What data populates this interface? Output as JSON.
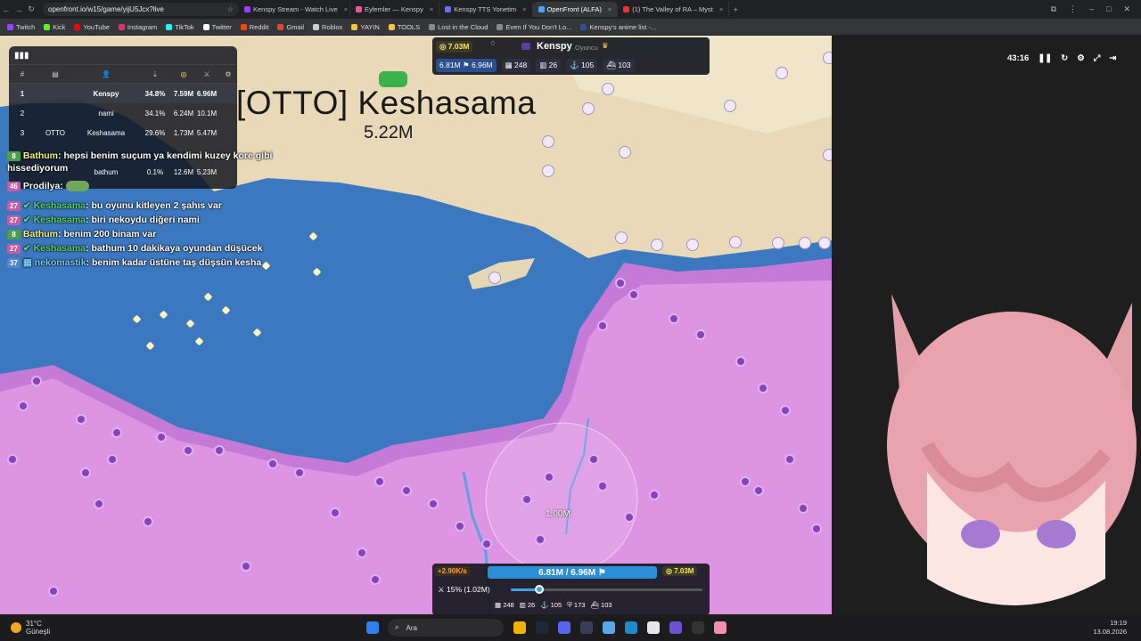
{
  "browser": {
    "url": "openfront.io/w15/game/yijU5Jcx?live",
    "tabs": [
      {
        "label": "Kenspy Stream - Watch Live",
        "color": "#9146ff"
      },
      {
        "label": "Eylemler — Kenspy",
        "color": "#ff4f9a"
      },
      {
        "label": "Kenspy TTS Yonetim",
        "color": "#6b6bff"
      },
      {
        "label": "OpenFront (ALFA)",
        "color": "#4fa3ff"
      },
      {
        "label": "(1) The Valley of RA – Myst",
        "color": "#ff2d2d"
      }
    ],
    "bookmarks": [
      {
        "label": "Twitch",
        "color": "#9146ff"
      },
      {
        "label": "Kick",
        "color": "#53fc18"
      },
      {
        "label": "YouTube",
        "color": "#ff0000"
      },
      {
        "label": "Instagram",
        "color": "#e1306c"
      },
      {
        "label": "TikTok",
        "color": "#25f4ee"
      },
      {
        "label": "Twitter",
        "color": "#ffffff"
      },
      {
        "label": "Reddit",
        "color": "#ff4500"
      },
      {
        "label": "Gmail",
        "color": "#ea4335"
      },
      {
        "label": "Roblox",
        "color": "#cccccc"
      },
      {
        "label": "YAYIN",
        "color": "#f5c542"
      },
      {
        "label": "TOOLS",
        "color": "#f5c542"
      },
      {
        "label": "Lost in the Cloud",
        "color": "#888888"
      },
      {
        "label": "Even If You Don't Lo...",
        "color": "#888888"
      },
      {
        "label": "Kenspy's anime list -...",
        "color": "#2e51a2"
      }
    ]
  },
  "map": {
    "player_name": "[OTTO] Keshasama",
    "player_troops": "5.22M",
    "cursor_label": "1.00M"
  },
  "leaderboard": {
    "rows": [
      {
        "rank": "1",
        "clan": "",
        "name": "Kenspy",
        "land": "34.8%",
        "gold": "7.59M",
        "troops": "6.96M",
        "me": true
      },
      {
        "rank": "2",
        "clan": "",
        "name": "nami",
        "land": "34.1%",
        "gold": "6.24M",
        "troops": "10.1M",
        "me": false
      },
      {
        "rank": "3",
        "clan": "OTTO",
        "name": "Keshasama",
        "land": "29.6%",
        "gold": "1.73M",
        "troops": "5.47M",
        "me": false
      },
      {
        "rank": "",
        "clan": "",
        "name": "bathum",
        "land": "0.1%",
        "gold": "12.6M",
        "troops": "5.23M",
        "me": false
      }
    ]
  },
  "chat": {
    "messages": [
      {
        "badge": "8",
        "badge_class": "b-green",
        "user": "Bathum",
        "user_class": "u-yellow",
        "verified": false,
        "text": "hepsi benim suçum ya kendimi kuzey kore gibi hissediyorum"
      },
      {
        "badge": "46",
        "badge_class": "b-pink",
        "user": "Prodilya",
        "user_class": "",
        "verified": false,
        "text": ""
      },
      {
        "badge": "27",
        "badge_class": "b-pink",
        "user": "Keshasama",
        "user_class": "u-green",
        "verified": true,
        "text": "bu oyunu kitleyen 2 şahıs var"
      },
      {
        "badge": "27",
        "badge_class": "b-pink",
        "user": "Keshasama",
        "user_class": "u-green",
        "verified": true,
        "text": "biri nekoydu diğeri nami"
      },
      {
        "badge": "8",
        "badge_class": "b-green",
        "user": "Bathum",
        "user_class": "u-yellow",
        "verified": false,
        "text": "benim 200 binam var"
      },
      {
        "badge": "27",
        "badge_class": "b-pink",
        "user": "Keshasama",
        "user_class": "u-green",
        "verified": true,
        "text": "bathum 10 dakikaya oyundan düşücek"
      },
      {
        "badge": "37",
        "badge_class": "b-blue",
        "user": "nekomastik",
        "user_class": "u-cyan",
        "verified": false,
        "text": "benim kadar üstüne taş düşsün kesha"
      }
    ]
  },
  "player_panel": {
    "gold": "7.03M",
    "name": "Kenspy",
    "role": "Oyuncu",
    "troops": "6.81M",
    "max_troops": "6.96M",
    "cities": "248",
    "factories": "26",
    "ports": "105",
    "warships": "103",
    "extra_count": "0"
  },
  "game_controls": {
    "timer": "43:16"
  },
  "control_panel": {
    "rate": "+2.90K/s",
    "troops_text": "6.81M / 6.96M",
    "gold": "7.03M",
    "attack_ratio": "15% (1.02M)",
    "ratio_fraction": 0.15,
    "cities": "248",
    "factories": "26",
    "ports": "105",
    "defense": "173",
    "warships": "103"
  },
  "taskbar": {
    "temp": "31°C",
    "weather": "Güneşli",
    "search_placeholder": "Ara",
    "time": "19:19",
    "date": "13.08.2026"
  }
}
